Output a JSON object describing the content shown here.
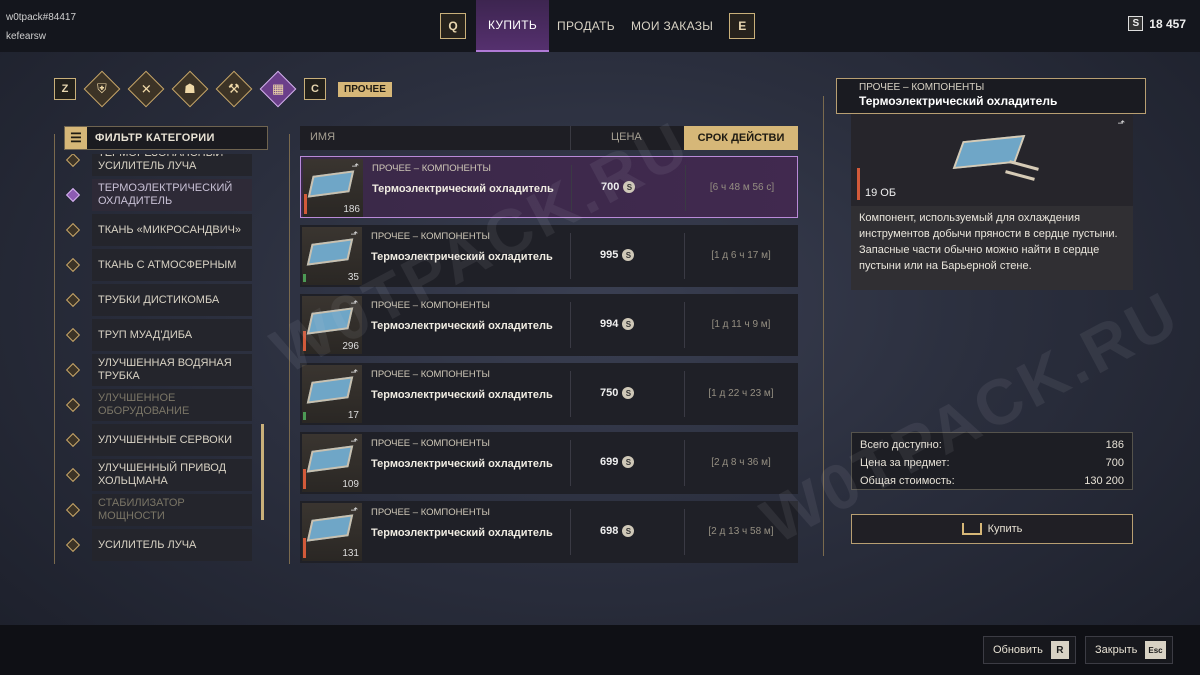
{
  "user": {
    "tag": "w0tpack#84417",
    "name": "kefearsw"
  },
  "nav": {
    "key_left": "Q",
    "key_right": "E",
    "tabs": [
      "КУПИТЬ",
      "ПРОДАТЬ",
      "МОИ ЗАКАЗЫ"
    ]
  },
  "currency": {
    "icon": "S",
    "amount": "18 457"
  },
  "categories": {
    "key_left": "Z",
    "key_right": "C",
    "active_label": "ПРОЧЕЕ",
    "icons": [
      "armor-icon",
      "weapons-icon",
      "utility-icon",
      "tools-icon",
      "misc-icon"
    ]
  },
  "filter": {
    "title": "ФИЛЬТР КАТЕГОРИИ",
    "items": [
      {
        "label": "ТЕРМОРЕЗОНАНСНЫЙ УСИЛИТЕЛЬ ЛУЧА"
      },
      {
        "label": "ТЕРМОЭЛЕКТРИЧЕСКИЙ ОХЛАДИТЕЛЬ"
      },
      {
        "label": "ТКАНЬ «МИКРОСАНДВИЧ»"
      },
      {
        "label": "ТКАНЬ С АТМОСФЕРНЫМ"
      },
      {
        "label": "ТРУБКИ ДИСТИКОМБА"
      },
      {
        "label": "ТРУП МУАД'ДИБА"
      },
      {
        "label": "УЛУЧШЕННАЯ ВОДЯНАЯ ТРУБКА"
      },
      {
        "label": "УЛУЧШЕННОЕ ОБОРУДОВАНИЕ"
      },
      {
        "label": "УЛУЧШЕННЫЕ СЕРВОКИ"
      },
      {
        "label": "УЛУЧШЕННЫЙ ПРИВОД ХОЛЬЦМАНА"
      },
      {
        "label": "СТАБИЛИЗАТОР МОЩНОСТИ"
      },
      {
        "label": "УСИЛИТЕЛЬ ЛУЧА"
      }
    ]
  },
  "table": {
    "headers": {
      "name": "ИМЯ",
      "price": "ЦЕНА",
      "expiry": "СРОК ДЕЙСТВИ"
    },
    "rows": [
      {
        "category": "ПРОЧЕЕ – КОМПОНЕНТЫ",
        "name": "Термоэлектрический охладитель",
        "qty": "186",
        "price": "700",
        "expiry": "[6 ч 48 м 56 с]"
      },
      {
        "category": "ПРОЧЕЕ – КОМПОНЕНТЫ",
        "name": "Термоэлектрический охладитель",
        "qty": "35",
        "price": "995",
        "expiry": "[1 д 6 ч 17 м]"
      },
      {
        "category": "ПРОЧЕЕ – КОМПОНЕНТЫ",
        "name": "Термоэлектрический охладитель",
        "qty": "296",
        "price": "994",
        "expiry": "[1 д 11 ч 9 м]"
      },
      {
        "category": "ПРОЧЕЕ – КОМПОНЕНТЫ",
        "name": "Термоэлектрический охладитель",
        "qty": "17",
        "price": "750",
        "expiry": "[1 д 22 ч 23 м]"
      },
      {
        "category": "ПРОЧЕЕ – КОМПОНЕНТЫ",
        "name": "Термоэлектрический охладитель",
        "qty": "109",
        "price": "699",
        "expiry": "[2 д 8 ч 36 м]"
      },
      {
        "category": "ПРОЧЕЕ – КОМПОНЕНТЫ",
        "name": "Термоэлектрический охладитель",
        "qty": "131",
        "price": "698",
        "expiry": "[2 д 13 ч 58 м]"
      }
    ]
  },
  "detail": {
    "category": "ПРОЧЕЕ – КОМПОНЕНТЫ",
    "name": "Термоэлектрический охладитель",
    "volume": "19 ОБ",
    "description": "Компонент, используемый для охлаждения инструментов добычи пряности в сердце пустыни. Запасные части обычно можно найти в сердце пустыни или на Барьерной стене.",
    "stats": [
      {
        "label": "Всего доступно:",
        "value": "186"
      },
      {
        "label": "Цена за предмет:",
        "value": "700"
      },
      {
        "label": "Общая стоимость:",
        "value": "130 200"
      }
    ],
    "buy_label": "Купить"
  },
  "bottom": {
    "refresh_label": "Обновить",
    "refresh_key": "R",
    "close_label": "Закрыть",
    "close_key": "Esc"
  },
  "watermark": "W0TPACK.RU",
  "colors": {
    "accent": "#d6b778",
    "selection": "#b98ad8",
    "active_tab": "#55306e"
  }
}
